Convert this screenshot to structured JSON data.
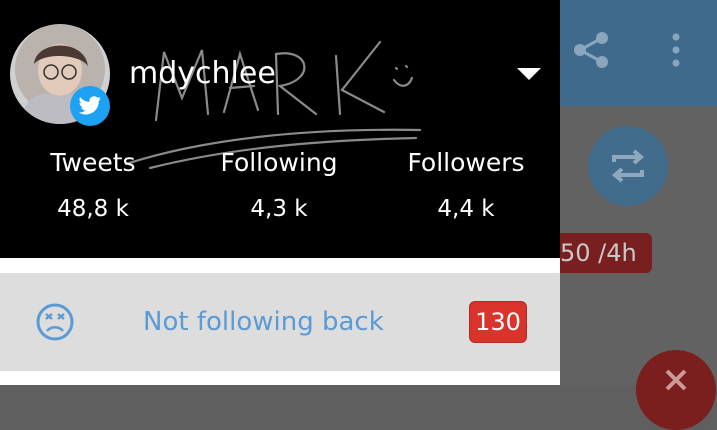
{
  "drawer": {
    "username": "mdychlee",
    "signature_text": "MARK",
    "stats": [
      {
        "label": "Tweets",
        "value": "48,8 k"
      },
      {
        "label": "Following",
        "value": "4,3 k"
      },
      {
        "label": "Followers",
        "value": "4,4 k"
      }
    ],
    "menu": {
      "label": "Not following back",
      "count": "130"
    }
  },
  "background": {
    "badge_text": "50 /4h"
  },
  "colors": {
    "header_bg": "#000000",
    "menu_bg": "#dddddd",
    "accent_blue": "#5b9bd5",
    "badge_red": "#d9342b",
    "toolbar_dim": "#3f6a8c"
  },
  "icons": [
    "share-icon",
    "more-vert-icon",
    "retweet-icon",
    "close-icon",
    "twitter-bird-icon",
    "dropdown-caret-icon",
    "sad-face-icon"
  ]
}
